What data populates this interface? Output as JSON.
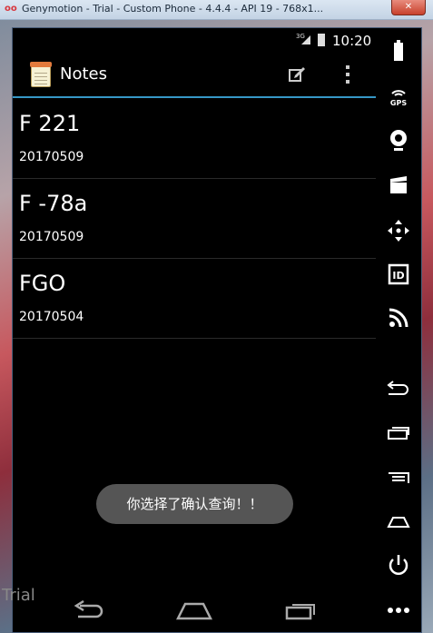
{
  "window": {
    "title": "Genymotion - Trial - Custom Phone - 4.4.4 - API 19 - 768x1...",
    "close_label": "✕"
  },
  "statusbar": {
    "network": "3G",
    "time": "10:20"
  },
  "actionbar": {
    "title": "Notes"
  },
  "notes": [
    {
      "title": "F 221",
      "date": "20170509"
    },
    {
      "title": "F -78a",
      "date": "20170509"
    },
    {
      "title": "FGO",
      "date": "20170504"
    }
  ],
  "toast": {
    "message": "你选择了确认查询！！"
  },
  "watermark": "Trial",
  "sidepanel": {
    "gps_label": "GPS",
    "id_label": "ID"
  },
  "colors": {
    "accent": "#3597c6",
    "toast_bg": "#555555"
  }
}
